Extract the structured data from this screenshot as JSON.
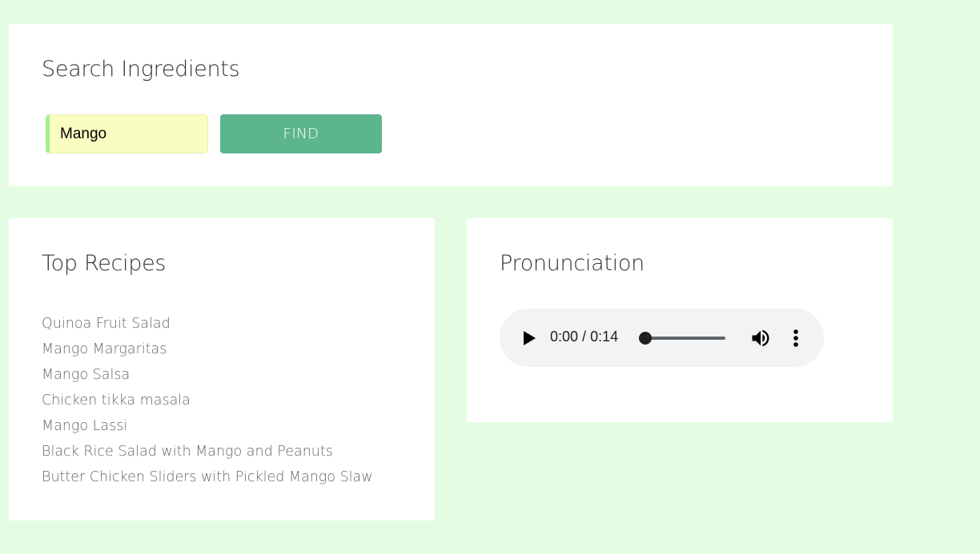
{
  "search": {
    "title": "Search Ingredients",
    "input_value": "Mango",
    "button_label": "FIND"
  },
  "recipes": {
    "title": "Top Recipes",
    "items": [
      "Quinoa Fruit Salad",
      "Mango Margaritas",
      "Mango Salsa",
      "Chicken tikka masala",
      "Mango Lassi",
      "Black Rice Salad with Mango and Peanuts",
      "Butter Chicken Sliders with Pickled Mango Slaw"
    ]
  },
  "pronunciation": {
    "title": "Pronunciation",
    "player": {
      "current_time": "0:00",
      "separator": "/",
      "duration": "0:14",
      "progress": 0,
      "icons": {
        "play": "play-icon",
        "volume": "volume-icon",
        "more": "more-vert-icon"
      }
    }
  },
  "colors": {
    "background": "#e4fde2",
    "accent_button": "#5db58e",
    "input_background": "#fafdc0",
    "input_accent": "#a6ee91"
  }
}
